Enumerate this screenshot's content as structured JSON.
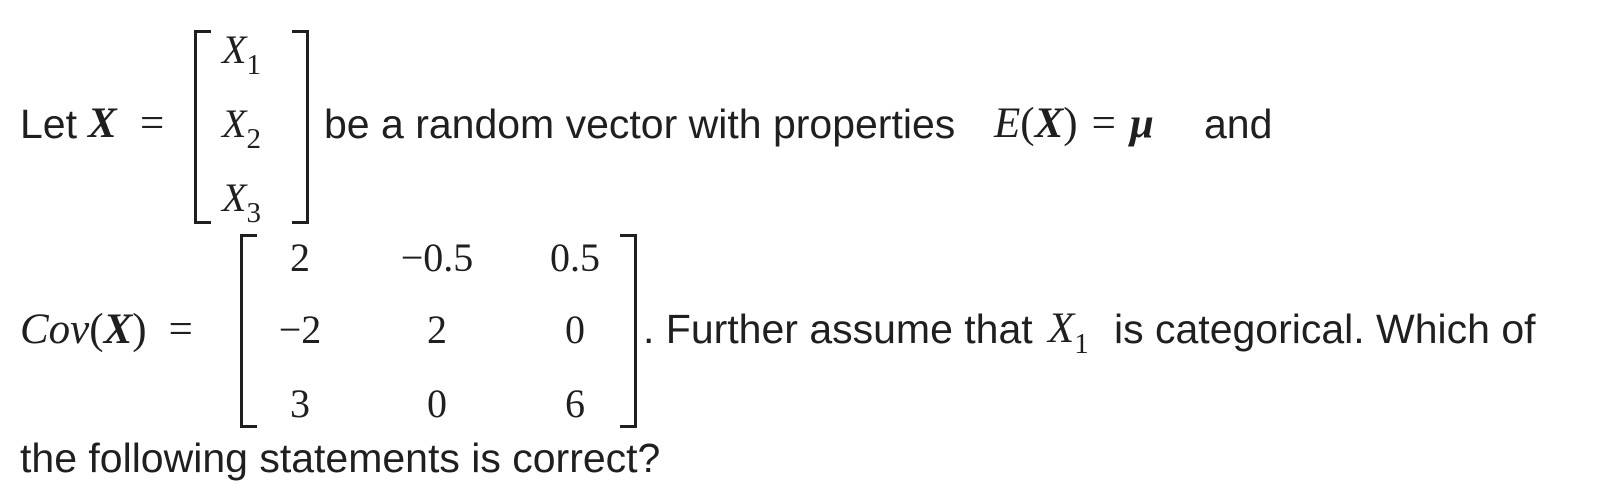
{
  "line1": {
    "let": "Let",
    "x_symbol": "X",
    "equals": "=",
    "vector_entries": [
      {
        "base": "X",
        "sub": "1"
      },
      {
        "base": "X",
        "sub": "2"
      },
      {
        "base": "X",
        "sub": "3"
      }
    ],
    "be_text": "be a random vector with properties",
    "expectation": {
      "E": "E",
      "open": "(",
      "X": "X",
      "close": ")",
      "equals": "=",
      "mu": "μ"
    },
    "and_text": "and"
  },
  "line2": {
    "cov_label": "Cov",
    "open": "(",
    "X": "X",
    "close": ")",
    "equals": "=",
    "matrix": [
      [
        "2",
        "−0.5",
        "0.5"
      ],
      [
        "−2",
        "2",
        "0"
      ],
      [
        "3",
        "0",
        "6"
      ]
    ],
    "further_text": ". Further assume that",
    "x1_base": "X",
    "x1_sub": "1",
    "categorical_text": "is  categorical. Which of"
  },
  "line3": {
    "text": "the following statements is correct?"
  }
}
